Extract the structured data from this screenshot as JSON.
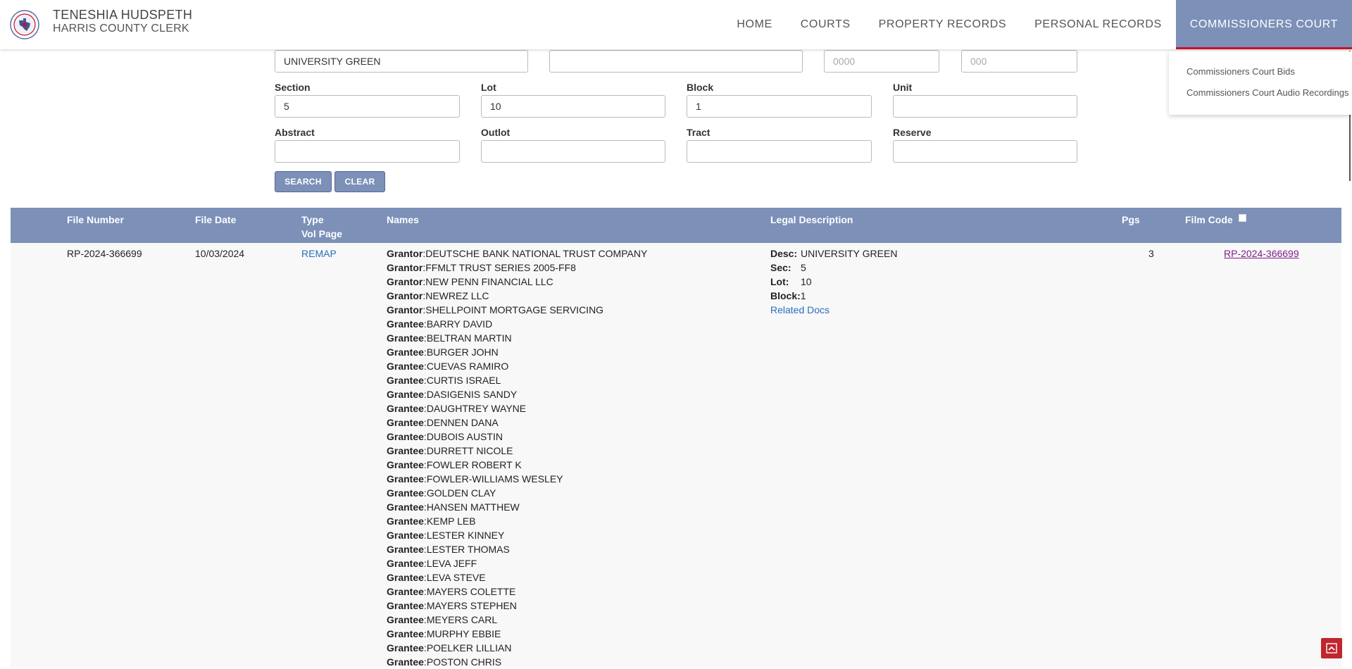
{
  "header": {
    "name": "TENESHIA HUDSPETH",
    "subtitle": "HARRIS COUNTY CLERK",
    "nav": [
      "HOME",
      "COURTS",
      "PROPERTY RECORDS",
      "PERSONAL RECORDS",
      "COMMISSIONERS COURT"
    ],
    "dropdown": [
      "Commissioners Court Bids",
      "Commissioners Court Audio Recordings"
    ]
  },
  "form": {
    "subdivision": "UNIVERSITY GREEN",
    "field2": "",
    "year_placeholder": "0000",
    "num_placeholder": "000",
    "section_label": "Section",
    "section": "5",
    "lot_label": "Lot",
    "lot": "10",
    "block_label": "Block",
    "block": "1",
    "unit_label": "Unit",
    "unit": "",
    "abstract_label": "Abstract",
    "outlot_label": "Outlot",
    "tract_label": "Tract",
    "reserve_label": "Reserve",
    "search_label": "SEARCH",
    "clear_label": "CLEAR"
  },
  "table": {
    "headers": {
      "file_number": "File Number",
      "file_date": "File Date",
      "type": "Type",
      "vol_page": "Vol Page",
      "names": "Names",
      "legal": "Legal Description",
      "pgs": "Pgs",
      "film_code": "Film Code"
    },
    "row": {
      "file_number": "RP-2024-366699",
      "file_date": "10/03/2024",
      "type": "REMAP",
      "pgs": "3",
      "film_code": "RP-2024-366699",
      "legal": {
        "desc_label": "Desc:",
        "desc": "UNIVERSITY GREEN",
        "sec_label": "Sec:",
        "sec": "5",
        "lot_label": "Lot:",
        "lot": "10",
        "block_label": "Block:",
        "block": "1",
        "related": "Related Docs"
      },
      "names": [
        {
          "role": "Grantor",
          "name": "DEUTSCHE BANK NATIONAL TRUST COMPANY"
        },
        {
          "role": "Grantor",
          "name": "FFMLT TRUST SERIES 2005-FF8"
        },
        {
          "role": "Grantor",
          "name": "NEW PENN FINANCIAL LLC"
        },
        {
          "role": "Grantor",
          "name": "NEWREZ LLC"
        },
        {
          "role": "Grantor",
          "name": "SHELLPOINT MORTGAGE SERVICING"
        },
        {
          "role": "Grantee",
          "name": "BARRY DAVID"
        },
        {
          "role": "Grantee",
          "name": "BELTRAN MARTIN"
        },
        {
          "role": "Grantee",
          "name": "BURGER JOHN"
        },
        {
          "role": "Grantee",
          "name": "CUEVAS RAMIRO"
        },
        {
          "role": "Grantee",
          "name": "CURTIS ISRAEL"
        },
        {
          "role": "Grantee",
          "name": "DASIGENIS SANDY"
        },
        {
          "role": "Grantee",
          "name": "DAUGHTREY WAYNE"
        },
        {
          "role": "Grantee",
          "name": "DENNEN DANA"
        },
        {
          "role": "Grantee",
          "name": "DUBOIS AUSTIN"
        },
        {
          "role": "Grantee",
          "name": "DURRETT NICOLE"
        },
        {
          "role": "Grantee",
          "name": "FOWLER ROBERT K"
        },
        {
          "role": "Grantee",
          "name": "FOWLER-WILLIAMS WESLEY"
        },
        {
          "role": "Grantee",
          "name": "GOLDEN CLAY"
        },
        {
          "role": "Grantee",
          "name": "HANSEN MATTHEW"
        },
        {
          "role": "Grantee",
          "name": "KEMP LEB"
        },
        {
          "role": "Grantee",
          "name": "LESTER KINNEY"
        },
        {
          "role": "Grantee",
          "name": "LESTER THOMAS"
        },
        {
          "role": "Grantee",
          "name": "LEVA JEFF"
        },
        {
          "role": "Grantee",
          "name": "LEVA STEVE"
        },
        {
          "role": "Grantee",
          "name": "MAYERS COLETTE"
        },
        {
          "role": "Grantee",
          "name": "MAYERS STEPHEN"
        },
        {
          "role": "Grantee",
          "name": "MEYERS CARL"
        },
        {
          "role": "Grantee",
          "name": "MURPHY EBBIE"
        },
        {
          "role": "Grantee",
          "name": "POELKER LILLIAN"
        },
        {
          "role": "Grantee",
          "name": "POSTON CHRIS"
        }
      ]
    }
  },
  "colors": {
    "accent": "#7c90b8",
    "active_border": "#c8102e",
    "link": "#2a6ebb",
    "visited": "#7d1f87",
    "back_to_top": "#c0262d"
  },
  "icons": [
    "county-seal-icon",
    "chevron-up-icon"
  ]
}
